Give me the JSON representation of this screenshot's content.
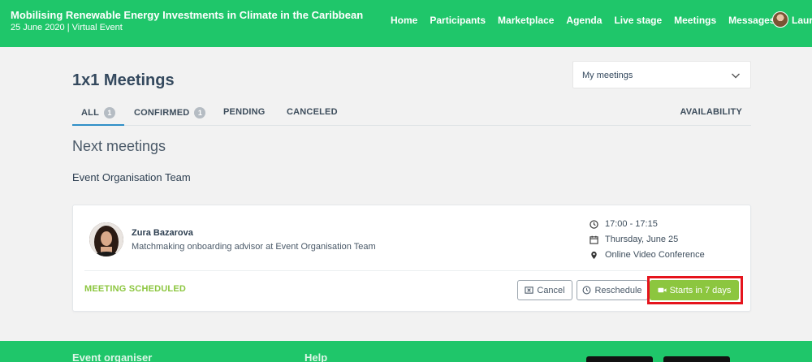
{
  "header": {
    "event_title": "Mobilising Renewable Energy Investments in Climate in the Caribbean",
    "event_subtitle": "25 June 2020 | Virtual Event",
    "nav": [
      "Home",
      "Participants",
      "Marketplace",
      "Agenda",
      "Live stage",
      "Meetings",
      "Messages"
    ],
    "user_name": "Laure"
  },
  "page": {
    "title": "1x1 Meetings",
    "select": {
      "value": "My meetings"
    },
    "tabs": [
      {
        "label": "ALL",
        "badge": "1"
      },
      {
        "label": "CONFIRMED",
        "badge": "1"
      },
      {
        "label": "PENDING"
      },
      {
        "label": "CANCELED"
      }
    ],
    "availability_label": "AVAILABILITY",
    "section_title": "Next meetings",
    "group_title": "Event Organisation Team"
  },
  "meeting": {
    "name": "Zura Bazarova",
    "role": "Matchmaking onboarding advisor at Event Organisation Team",
    "time": "17:00 - 17:15",
    "date": "Thursday, June 25",
    "location": "Online Video Conference",
    "status": "MEETING SCHEDULED",
    "cancel_label": "Cancel",
    "reschedule_label": "Reschedule",
    "start_label": "Starts in 7 days"
  },
  "footer": {
    "col1": "Event organiser",
    "col2": "Help"
  },
  "colors": {
    "brand_green": "#1fc66a",
    "accent_green": "#8cc63f",
    "highlight_red": "#e5141d",
    "tab_underline": "#2f8fc7"
  }
}
